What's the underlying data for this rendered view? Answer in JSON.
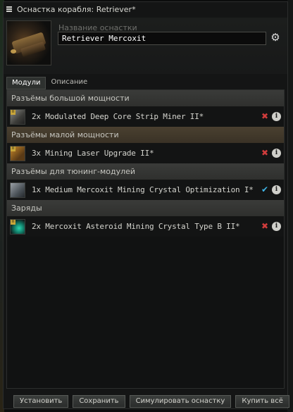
{
  "window": {
    "title": "Оснастка корабля: Retriever*"
  },
  "header": {
    "fit_label": "Название оснастки",
    "fit_name": "Retriever Mercoxit",
    "ship_icon": "retriever-ship-image"
  },
  "tabs": [
    {
      "label": "Модули"
    },
    {
      "label": "Описание"
    }
  ],
  "sections": {
    "high": "Разъёмы большой мощности",
    "low": "Разъёмы малой мощности",
    "rigs": "Разъёмы для тюнинг-модулей",
    "charges": "Заряды"
  },
  "modules": {
    "high": {
      "text": "2x Modulated Deep Core Strip Miner II*",
      "status": "missing"
    },
    "low": {
      "text": "3x Mining Laser Upgrade II*",
      "status": "missing"
    },
    "rig": {
      "text": "1x Medium Mercoxit Mining Crystal Optimization I*",
      "status": "available"
    },
    "charge": {
      "text": "2x Mercoxit Asteroid Mining Crystal Type B II*",
      "status": "missing"
    }
  },
  "icons": {
    "missing": "✖",
    "available": "✔",
    "info": "i"
  },
  "colors": {
    "missing": "#d03c3c",
    "available": "#3fb4e6"
  },
  "buttons": {
    "install": "Установить",
    "save": "Сохранить",
    "simulate": "Симулировать оснастку",
    "buy_all": "Купить всё"
  }
}
